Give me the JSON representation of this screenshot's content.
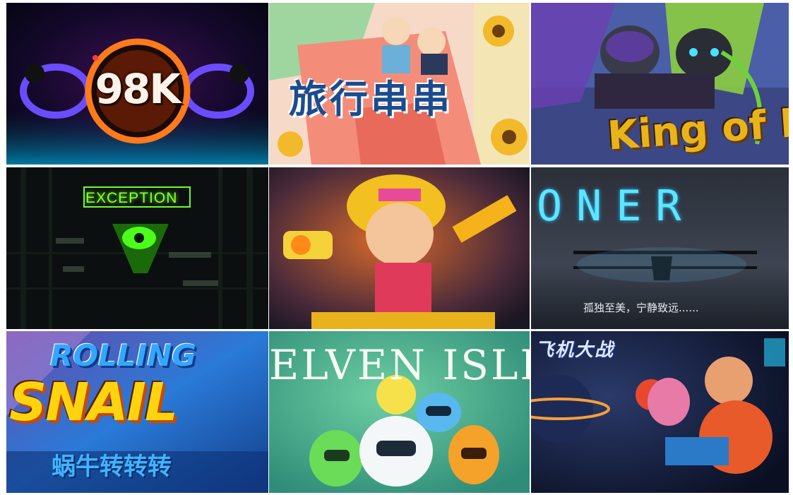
{
  "tiles": [
    {
      "title": "98K",
      "name": "tile-98k"
    },
    {
      "title": "旅行串串",
      "name": "tile-lvxing-chuanchuan"
    },
    {
      "title": "King of Kings",
      "name": "tile-king-of-kings"
    },
    {
      "title": "EXCEPTION",
      "name": "tile-exception"
    },
    {
      "title": "",
      "name": "tile-hero-shooter"
    },
    {
      "title": "ONER",
      "subtitle": "孤独至美，宁静致远......",
      "name": "tile-oner"
    },
    {
      "title": "ROLLING",
      "title2": "SNAIL",
      "subtitle": "蜗牛转转转",
      "name": "tile-rolling-snail"
    },
    {
      "title": "ELVEN ISLE",
      "name": "tile-elven-isle"
    },
    {
      "title": "飞机大战",
      "name": "tile-space-fighters"
    }
  ]
}
